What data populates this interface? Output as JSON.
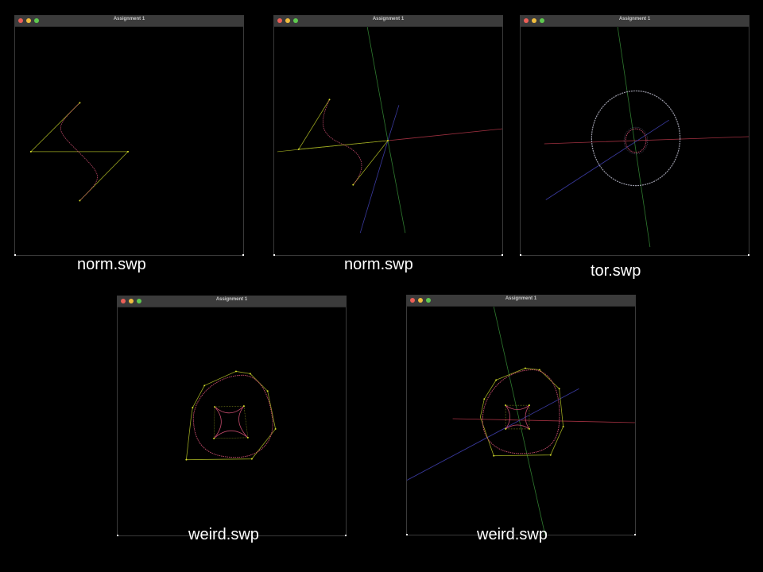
{
  "windows": [
    {
      "title": "Assignment 1",
      "caption": "norm.swp"
    },
    {
      "title": "Assignment 1",
      "caption": "norm.swp"
    },
    {
      "title": "Assignment 1",
      "caption": "tor.swp"
    },
    {
      "title": "Assignment 1",
      "caption": "weird.swp"
    },
    {
      "title": "Assignment 1",
      "caption": "weird.swp"
    }
  ],
  "colors": {
    "control_polygon": "#9aa520",
    "curve": "#c04a6a",
    "control_point": "#d9e02a",
    "axis_x": "#a03040",
    "axis_y": "#2f7a2f",
    "axis_z": "#3a3aa0",
    "torus": "#9a9aa8"
  }
}
